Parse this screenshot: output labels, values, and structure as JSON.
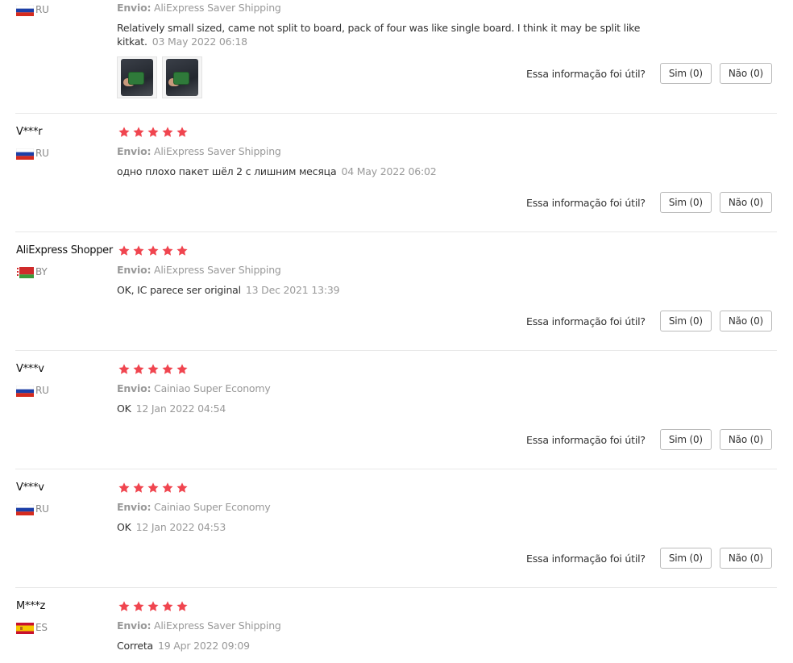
{
  "labels": {
    "shipping_prefix": "Envio:",
    "helpful_question": "Essa informação foi útil?",
    "yes_label": "Sim (0)",
    "no_label": "Não (0)"
  },
  "reviews": [
    {
      "name": "",
      "country": "RU",
      "shipping": "AliExpress Saver Shipping",
      "text": "Relatively small sized, came not split to board, pack of four was like single board. I think it may be split like kitkat.",
      "date": "03 May 2022 06:18",
      "photos": [
        "photo-1",
        "photo-2"
      ]
    },
    {
      "name": "V***r",
      "country": "RU",
      "rating": 5,
      "shipping": "AliExpress Saver Shipping",
      "text": "одно плохо пакет шёл 2 с лишним месяца",
      "date": "04 May 2022 06:02"
    },
    {
      "name": "AliExpress Shopper",
      "country": "BY",
      "rating": 5,
      "shipping": "AliExpress Saver Shipping",
      "text": "OK, IC parece ser original",
      "date": "13 Dec 2021 13:39"
    },
    {
      "name": "V***v",
      "country": "RU",
      "rating": 5,
      "shipping": "Cainiao Super Economy",
      "text": "OK",
      "date": "12 Jan 2022 04:54"
    },
    {
      "name": "V***v",
      "country": "RU",
      "rating": 5,
      "shipping": "Cainiao Super Economy",
      "text": "OK",
      "date": "12 Jan 2022 04:53"
    },
    {
      "name": "M***z",
      "country": "ES",
      "rating": 5,
      "shipping": "AliExpress Saver Shipping",
      "text": "Correta",
      "date": "19 Apr 2022 09:09"
    }
  ],
  "colors": {
    "star": "#f0454f",
    "muted_text": "#999999",
    "divider": "#e8e8e8"
  }
}
